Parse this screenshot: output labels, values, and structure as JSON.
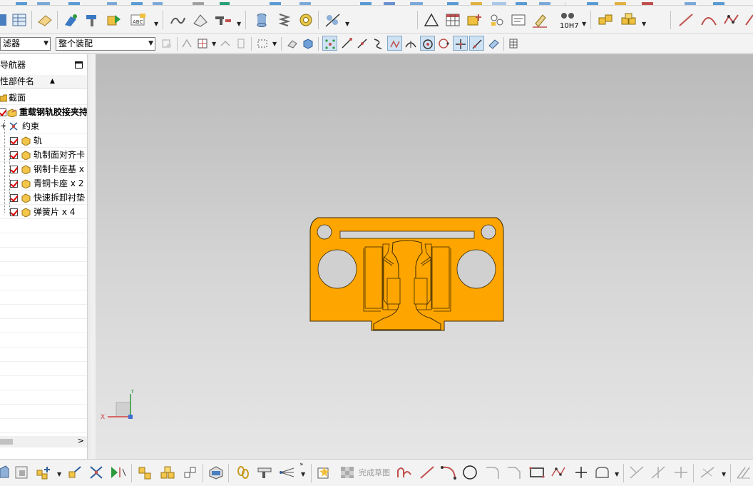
{
  "colors": {
    "model_fill": "#ffa500",
    "model_stroke": "#3a2a00",
    "check_red": "#dd0000"
  },
  "selection_bar": {
    "type_filter": "滤器",
    "scope": "整个装配"
  },
  "toolbar_main": {
    "tolerance_label": "10H7"
  },
  "navigator": {
    "title": "导航器",
    "column_header": "性部件名",
    "items": [
      {
        "label": "截面",
        "icon": "folder-icon"
      },
      {
        "label": "重载钢轨胶接夹持",
        "icon": "assembly-icon",
        "checked": true
      },
      {
        "label": "约束",
        "icon": "constraints-icon"
      },
      {
        "label": "轨",
        "icon": "part-icon",
        "checked": true
      },
      {
        "label": "轨制面对齐卡",
        "icon": "part-icon",
        "checked": true
      },
      {
        "label": "钢制卡座基 x",
        "icon": "part-icon",
        "checked": true
      },
      {
        "label": "青铜卡座 x 2",
        "icon": "part-icon",
        "checked": true
      },
      {
        "label": "快速拆卸衬垫",
        "icon": "part-icon",
        "checked": true
      },
      {
        "label": "弹簧片 x 4",
        "icon": "part-icon",
        "checked": true
      }
    ]
  },
  "axis": {
    "x": "X",
    "y": "Y"
  },
  "bottom_toolbar": {
    "finish_sketch": "完成草图"
  }
}
